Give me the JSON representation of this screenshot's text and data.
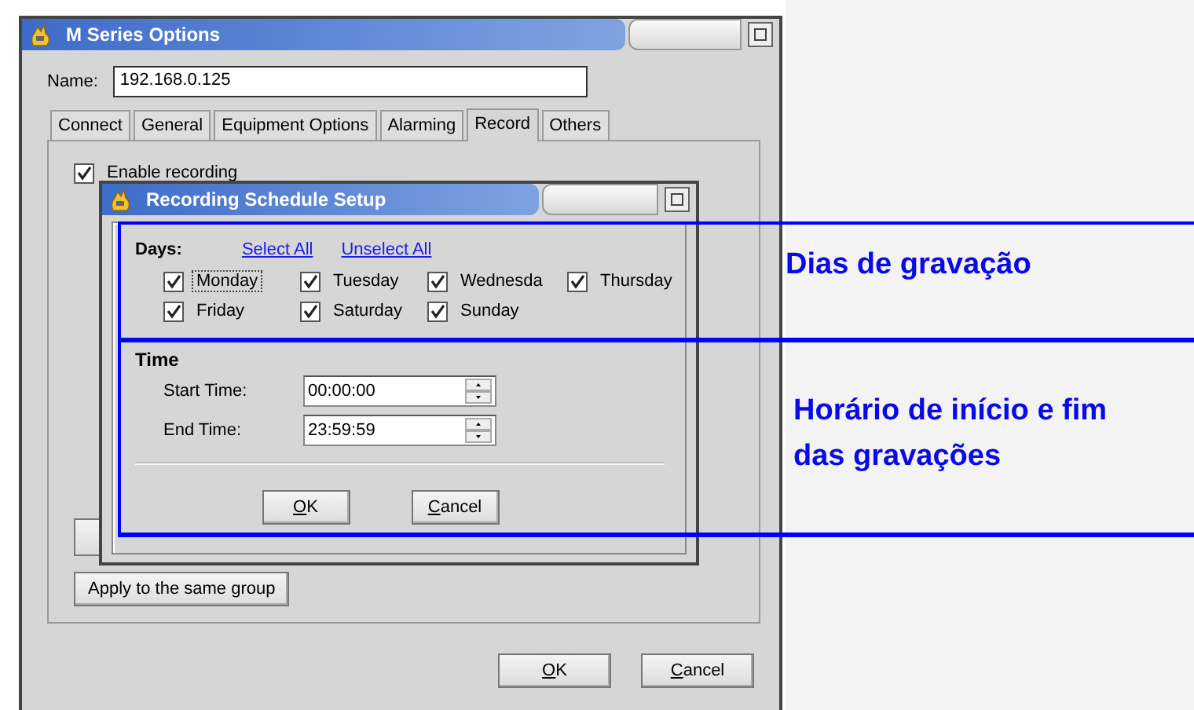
{
  "main_window": {
    "title": "M Series Options",
    "name_label": "Name:",
    "name_value": "192.168.0.125",
    "tabs": [
      {
        "label": "Connect",
        "selected": false
      },
      {
        "label": "General",
        "selected": false
      },
      {
        "label": "Equipment Options",
        "selected": false
      },
      {
        "label": "Alarming",
        "selected": false
      },
      {
        "label": "Record",
        "selected": true
      },
      {
        "label": "Others",
        "selected": false
      }
    ],
    "enable_recording": {
      "label": "Enable recording",
      "checked": true
    },
    "apply_button": "Apply to the same group",
    "buttons": [
      "OK",
      "Cancel"
    ]
  },
  "dialog": {
    "title": "Recording Schedule Setup",
    "days_label": "Days:",
    "links": [
      "Select All",
      "Unselect All"
    ],
    "days": [
      {
        "label": "Monday",
        "checked": true,
        "focused": true
      },
      {
        "label": "Tuesday",
        "checked": true,
        "focused": false
      },
      {
        "label": "Wednesda",
        "checked": true,
        "focused": false
      },
      {
        "label": "Thursday",
        "checked": true,
        "focused": false
      },
      {
        "label": "Friday",
        "checked": true,
        "focused": false
      },
      {
        "label": "Saturday",
        "checked": true,
        "focused": false
      },
      {
        "label": "Sunday",
        "checked": true,
        "focused": false
      }
    ],
    "time_label": "Time",
    "times": [
      {
        "label": "Start Time:",
        "value": "00:00:00"
      },
      {
        "label": "End Time:",
        "value": "23:59:59"
      }
    ],
    "buttons": [
      "OK",
      "Cancel"
    ]
  },
  "annotations": [
    {
      "text": "Dias de gravação"
    },
    {
      "text": "Horário de início e fim das gravações"
    }
  ]
}
